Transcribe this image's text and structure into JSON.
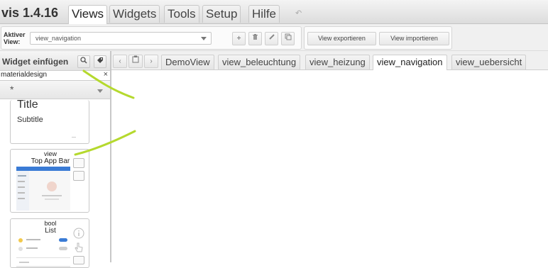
{
  "app": {
    "title": "vis 1.4.16"
  },
  "menu": {
    "tabs": [
      "Views",
      "Widgets",
      "Tools",
      "Setup",
      "Hilfe"
    ],
    "active": "Views"
  },
  "toolbar": {
    "active_view_label_1": "Aktiver",
    "active_view_label_2": "View:",
    "active_view_value": "view_navigation",
    "export_label": "View exportieren",
    "import_label": "View importieren",
    "icons": [
      "plus-icon",
      "trash-icon",
      "pencil-icon",
      "copy-icon"
    ]
  },
  "widget_panel": {
    "title": "Widget einfügen",
    "filter_value": "materialdesign",
    "clear_label": "×",
    "set_value": "*",
    "cards": [
      {
        "type": "",
        "name": "",
        "preview_title": "Title",
        "preview_subtitle": "Subtitle"
      },
      {
        "type": "view",
        "name": "Top App Bar"
      },
      {
        "type": "bool",
        "name": "List"
      }
    ]
  },
  "views": {
    "tabs": [
      "DemoView",
      "view_beleuchtung",
      "view_heizung",
      "view_navigation",
      "view_uebersicht"
    ],
    "active": "view_navigation"
  },
  "colors": {
    "scribble": "#b5d92e",
    "accent_blue": "#3a7bd5"
  }
}
